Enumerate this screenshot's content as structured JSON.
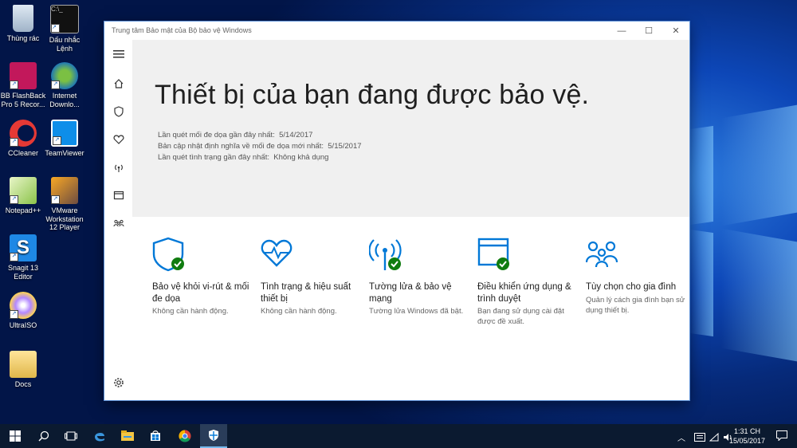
{
  "desktop": {
    "icons": [
      {
        "label": "Thùng rác",
        "icon": "recycle-bin"
      },
      {
        "label": "Dấu nhắc Lệnh",
        "icon": "command-prompt"
      },
      {
        "label": "BB FlashBack Pro 5 Recor...",
        "icon": "flashback"
      },
      {
        "label": "Internet Downlo...",
        "icon": "internet-download-manager"
      },
      {
        "label": "CCleaner",
        "icon": "ccleaner"
      },
      {
        "label": "TeamViewer",
        "icon": "teamviewer"
      },
      {
        "label": "Notepad++",
        "icon": "notepad-plus-plus"
      },
      {
        "label": "VMware Workstation 12 Player",
        "icon": "vmware"
      },
      {
        "label": "Snagit 13 Editor",
        "icon": "snagit"
      },
      {
        "label": "UltraISO",
        "icon": "ultraiso"
      },
      {
        "label": "Docs",
        "icon": "folder"
      }
    ]
  },
  "window": {
    "title": "Trung tâm Bảo mật của Bộ bảo vệ Windows",
    "controls": {
      "minimize": "—",
      "maximize": "☐",
      "close": "✕"
    }
  },
  "hero": {
    "headline": "Thiết bị của bạn đang được bảo vệ.",
    "lines": [
      {
        "label": "Lần quét mối đe dọa gần đây nhất:",
        "value": "5/14/2017"
      },
      {
        "label": "Bản cập nhật định nghĩa về mối đe dọa mới nhất:",
        "value": "5/15/2017"
      },
      {
        "label": "Lần quét tình trạng gần đây nhất:",
        "value": "Không khả dụng"
      }
    ]
  },
  "tiles": [
    {
      "name": "Bảo vệ khỏi vi-rút & mối đe dọa",
      "desc": "Không cần hành động.",
      "icon": "shield-icon",
      "ok": true
    },
    {
      "name": "Tình trạng & hiệu suất thiết bị",
      "desc": "Không cần hành động.",
      "icon": "heart-pulse-icon",
      "ok": false
    },
    {
      "name": "Tường lửa & bảo vệ mạng",
      "desc": "Tường lửa Windows đã bật.",
      "icon": "wireless-icon",
      "ok": true
    },
    {
      "name": "Điều khiển ứng dụng & trình duyệt",
      "desc": "Bạn đang sử dụng cài đặt được đề xuất.",
      "icon": "browser-window-icon",
      "ok": true
    },
    {
      "name": "Tùy chọn cho gia đình",
      "desc": "Quản lý cách gia đình bạn sử dụng thiết bị.",
      "icon": "family-icon",
      "ok": false
    }
  ],
  "taskbar": {
    "time": "1:31 CH",
    "date": "15/05/2017"
  },
  "colors": {
    "accent": "#0078d7",
    "ok": "#107c10"
  }
}
